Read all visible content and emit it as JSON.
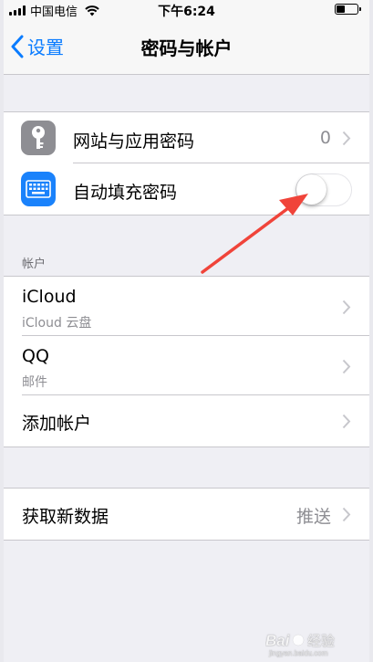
{
  "status_bar": {
    "carrier": "中国电信",
    "time": "下午6:24"
  },
  "nav": {
    "back_label": "设置",
    "title": "密码与帐户"
  },
  "group_passwords": [
    {
      "icon": "key-icon",
      "title": "网站与应用密码",
      "value": "0"
    },
    {
      "icon": "keyboard-icon",
      "title": "自动填充密码",
      "toggle_on": false
    }
  ],
  "accounts_header": "帐户",
  "accounts": [
    {
      "title": "iCloud",
      "subtitle": "iCloud 云盘"
    },
    {
      "title": "QQ",
      "subtitle": "邮件"
    },
    {
      "title": "添加帐户"
    }
  ],
  "fetch": {
    "title": "获取新数据",
    "value": "推送"
  },
  "colors": {
    "accent": "#0a7cff",
    "key_icon_bg": "#8e8e93",
    "keyboard_icon_bg": "#1a82fb",
    "arrow": "#f0443a"
  },
  "watermark": "Bai 经验 jingyan.baidu.com"
}
